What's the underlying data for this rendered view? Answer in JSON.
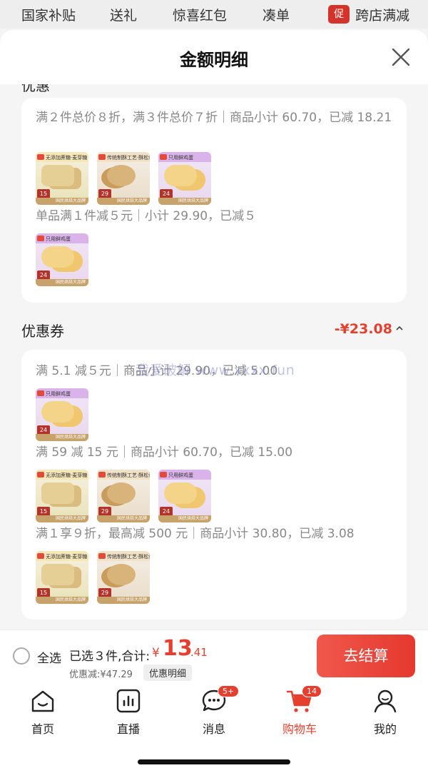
{
  "top_categories": [
    "国家补贴",
    "送礼",
    "惊喜红包",
    "凑单"
  ],
  "top_promo": {
    "chip": "促",
    "label": "跨店满减"
  },
  "sheet": {
    "title": "金额明细",
    "cut_text": "优惠",
    "groups": [
      {
        "rule": "满２件总价８折，满３件总价７折｜商品小计 60.70，已减 18.21",
        "thumbs": [
          "wheat",
          "round",
          "egg"
        ]
      },
      {
        "rule": "单品满１件减５元｜小计 29.90，已减５",
        "thumbs": [
          "egg"
        ]
      }
    ],
    "coupon_section": {
      "title": "优惠券",
      "amount": "-¥23.08",
      "groups": [
        {
          "rule": "满 5.1 减５元｜商品小计 29.90，已减 5.00",
          "thumbs": [
            "egg"
          ]
        },
        {
          "rule": "满 59 减 15 元｜商品小计 60.70，已减 15.00",
          "thumbs": [
            "wheat",
            "round",
            "egg"
          ]
        },
        {
          "rule": "满１享９折，最高减 500 元｜商品小计 30.80，已减 3.08",
          "thumbs": [
            "wheat",
            "round"
          ]
        }
      ]
    },
    "watermark": "我爱破解 www.xxxx.fun"
  },
  "product_thumb": {
    "band_texts": {
      "wheat": "无添加蔗糖·麦芽糖",
      "round": "传统制酥工艺·酥松香脆",
      "egg": "只用鲜鸡蛋"
    },
    "price_badges": {
      "wheat": "15",
      "round": "29",
      "egg": "24"
    },
    "foot": "国民烘焙大品牌"
  },
  "checkout": {
    "select_all": "全选",
    "selected_text": "已选３件,合计:",
    "currency": "¥",
    "total_int": "13",
    "total_dec": ".41",
    "discount": "优惠减:¥47.29",
    "detail_chip": "优惠明细",
    "pay_button": "去结算"
  },
  "tabs": [
    {
      "label": "首页",
      "icon": "home-icon"
    },
    {
      "label": "直播",
      "icon": "live-icon"
    },
    {
      "label": "消息",
      "icon": "message-icon",
      "badge": "5+"
    },
    {
      "label": "购物车",
      "icon": "cart-icon",
      "badge": "14",
      "active": true
    },
    {
      "label": "我的",
      "icon": "profile-icon"
    }
  ],
  "colors": {
    "accent": "#e5402f",
    "muted": "#888888",
    "card": "#ffffff",
    "bg": "#f5f5f5"
  }
}
